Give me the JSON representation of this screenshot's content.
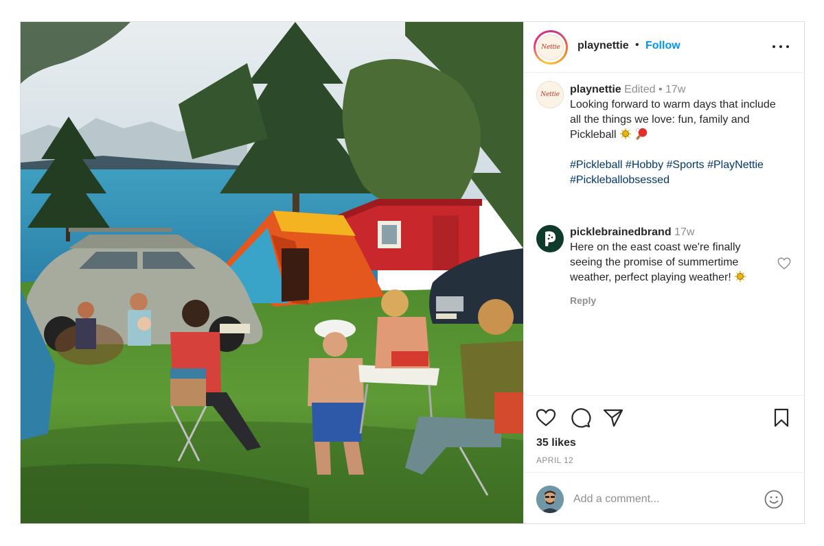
{
  "post": {
    "author": "playnettie",
    "dot": "•",
    "follow_label": "Follow",
    "avatar_text": "Nettie"
  },
  "caption": {
    "username": "playnettie",
    "edited": "Edited",
    "dot": "•",
    "time": "17w",
    "text": "Looking forward to warm days that include all the things we love: fun, family and Pickleball",
    "hashtags": "#Pickleball #Hobby #Sports #PlayNettie #Pickleballobsessed"
  },
  "comments": [
    {
      "username": "picklebrainedbrand",
      "time": "17w",
      "text": "Here on the east coast we're finally seeing the promise of summertime weather, perfect playing weather!",
      "reply_label": "Reply"
    }
  ],
  "engagement": {
    "likes": "35 likes",
    "date": "APRIL 12"
  },
  "add_comment": {
    "placeholder": "Add a comment..."
  },
  "icons": {
    "more": "more-options-icon",
    "like": "heart-icon",
    "comment": "comment-bubble-icon",
    "share": "paper-plane-icon",
    "save": "bookmark-icon",
    "emoji": "smiley-icon"
  },
  "colors": {
    "follow": "#0095f6",
    "hashtag": "#00376b",
    "meta": "#8e8e8e"
  }
}
